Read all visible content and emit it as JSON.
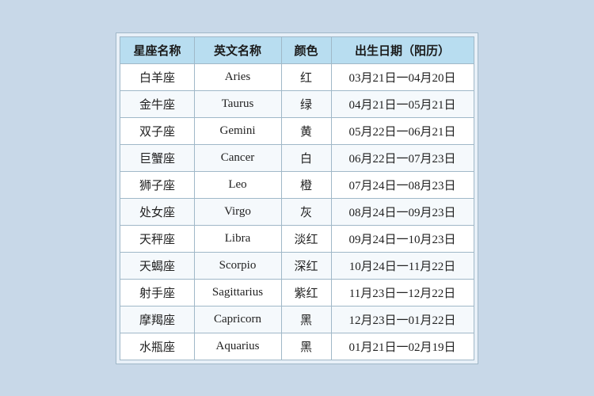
{
  "header": {
    "col1": "星座名称",
    "col2": "英文名称",
    "col3": "颜色",
    "col4": "出生日期（阳历）"
  },
  "rows": [
    {
      "chinese": "白羊座",
      "english": "Aries",
      "color": "红",
      "date": "03月21日一04月20日"
    },
    {
      "chinese": "金牛座",
      "english": "Taurus",
      "color": "绿",
      "date": "04月21日一05月21日"
    },
    {
      "chinese": "双子座",
      "english": "Gemini",
      "color": "黄",
      "date": "05月22日一06月21日"
    },
    {
      "chinese": "巨蟹座",
      "english": "Cancer",
      "color": "白",
      "date": "06月22日一07月23日"
    },
    {
      "chinese": "狮子座",
      "english": "Leo",
      "color": "橙",
      "date": "07月24日一08月23日"
    },
    {
      "chinese": "处女座",
      "english": "Virgo",
      "color": "灰",
      "date": "08月24日一09月23日"
    },
    {
      "chinese": "天秤座",
      "english": "Libra",
      "color": "淡红",
      "date": "09月24日一10月23日"
    },
    {
      "chinese": "天蝎座",
      "english": "Scorpio",
      "color": "深红",
      "date": "10月24日一11月22日"
    },
    {
      "chinese": "射手座",
      "english": "Sagittarius",
      "color": "紫红",
      "date": "11月23日一12月22日"
    },
    {
      "chinese": "摩羯座",
      "english": "Capricorn",
      "color": "黑",
      "date": "12月23日一01月22日"
    },
    {
      "chinese": "水瓶座",
      "english": "Aquarius",
      "color": "黑",
      "date": "01月21日一02月19日"
    }
  ]
}
